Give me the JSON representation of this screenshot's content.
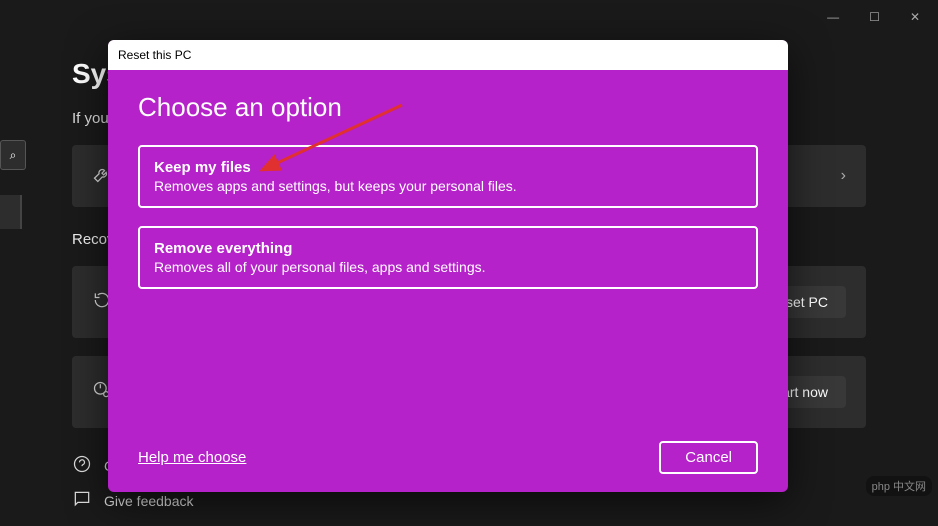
{
  "window_controls": {
    "min": "—",
    "max": "☐",
    "close": "✕"
  },
  "background": {
    "title": "Sys",
    "subtitle_prefix": "If you'",
    "recovery_label": "Recov",
    "reset_btn": "eset PC",
    "start_btn": "start now",
    "feedback_items": [
      "G",
      "Give feedback"
    ]
  },
  "search": {
    "icon": "⌕"
  },
  "modal": {
    "header": "Reset this PC",
    "title": "Choose an option",
    "options": [
      {
        "title": "Keep my files",
        "desc": "Removes apps and settings, but keeps your personal files."
      },
      {
        "title": "Remove everything",
        "desc": "Removes all of your personal files, apps and settings."
      }
    ],
    "help": "Help me choose",
    "cancel": "Cancel"
  },
  "watermark": "php 中文网"
}
